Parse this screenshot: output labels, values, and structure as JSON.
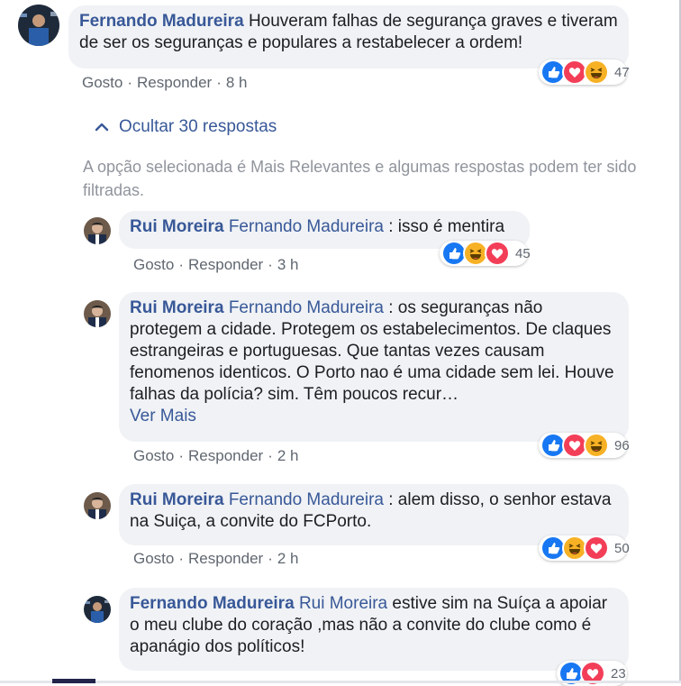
{
  "meta_labels": {
    "like": "Gosto",
    "reply": "Responder",
    "separator": "·"
  },
  "hide_replies_label": "Ocultar 30 respostas",
  "filter_note": "A opção selecionada é Mais Relevantes e algumas respostas podem ter sido filtradas.",
  "comments": [
    {
      "author": "Fernando Madureira",
      "mention": "",
      "text": "Houveram falhas de segurança graves e tiveram de ser os seguranças e populares a restabelecer a ordem!",
      "more": "",
      "time": "8 h",
      "reactions": [
        "like-reaction-icon",
        "love-reaction-icon",
        "haha-reaction-icon"
      ],
      "reaction_count": "47"
    },
    {
      "author": "Rui Moreira",
      "mention": "Fernando Madureira",
      "text": ": isso é mentira",
      "more": "",
      "time": "3 h",
      "reactions": [
        "like-reaction-icon",
        "haha-reaction-icon",
        "love-reaction-icon"
      ],
      "reaction_count": "45"
    },
    {
      "author": "Rui Moreira",
      "mention": "Fernando Madureira",
      "text": ": os seguranças não protegem a cidade. Protegem os estabelecimentos. De claques estrangeiras e portuguesas. Que tantas vezes causam fenomenos identicos. O Porto nao é uma cidade sem lei. Houve falhas da polícia? sim. Têm poucos recur…",
      "more": "Ver Mais",
      "time": "2 h",
      "reactions": [
        "like-reaction-icon",
        "love-reaction-icon",
        "haha-reaction-icon"
      ],
      "reaction_count": "96"
    },
    {
      "author": "Rui Moreira",
      "mention": "Fernando Madureira",
      "text": ": alem disso, o senhor estava na Suiça, a convite do FCPorto.",
      "more": "",
      "time": "2 h",
      "reactions": [
        "like-reaction-icon",
        "haha-reaction-icon",
        "love-reaction-icon"
      ],
      "reaction_count": "50"
    },
    {
      "author": "Fernando Madureira",
      "mention": "Rui Moreira",
      "text": "estive sim na Suíça a apoiar o meu clube do coração ,mas não a convite do clube como é apanágio dos políticos!",
      "more": "",
      "time": "",
      "reactions": [
        "like-reaction-icon",
        "love-reaction-icon"
      ],
      "reaction_count": "23"
    }
  ],
  "colors": {
    "link": "#385898",
    "meta": "#606770",
    "bubble": "#f0f2f5",
    "like": "#1877f2",
    "love": "#f33e58",
    "haha": "#f7b125"
  }
}
